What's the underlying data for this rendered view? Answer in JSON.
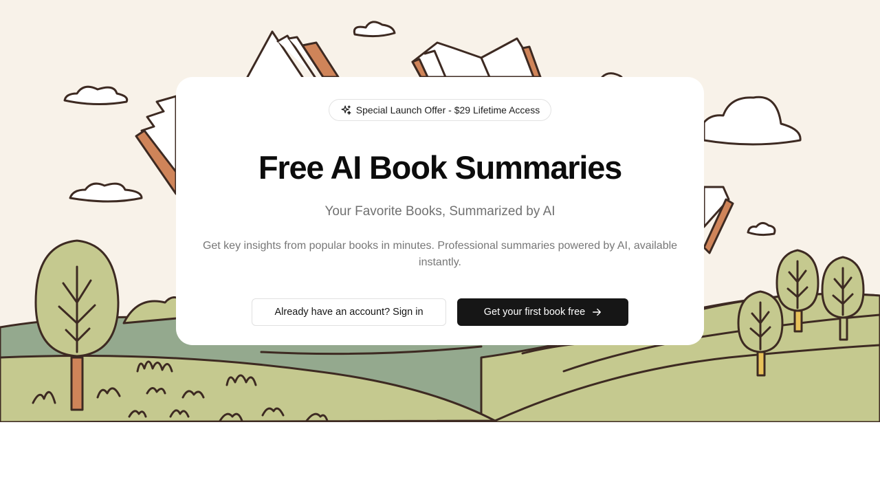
{
  "badge": {
    "icon": "sparkle-icon",
    "text": "Special Launch Offer - $29 Lifetime Access"
  },
  "hero": {
    "title": "Free AI Book Summaries",
    "subtitle": "Your Favorite Books, Summarized by AI",
    "description": "Get key insights from popular books in minutes. Professional summaries powered by AI, available instantly."
  },
  "actions": {
    "signin_label": "Already have an account? Sign in",
    "primary_label": "Get your first book free",
    "primary_icon": "arrow-right-icon"
  },
  "colors": {
    "background": "#f8f2e9",
    "card": "#ffffff",
    "ink": "#3d2a22",
    "sage_green": "#94a98e",
    "light_green": "#c5c98f",
    "book_spine": "#cf8459",
    "primary_button": "#161616"
  }
}
